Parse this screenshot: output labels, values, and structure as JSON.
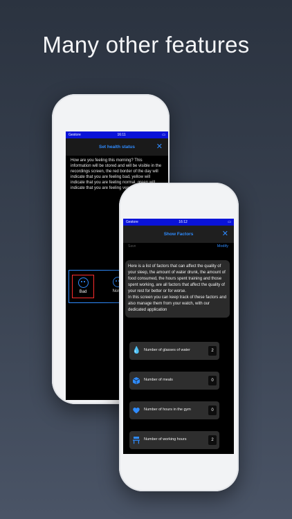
{
  "headline": "Many other features",
  "back_phone": {
    "status": {
      "carrier": "Gestore",
      "time": "16:11"
    },
    "title": "Set health status",
    "description": "How are you feeling this morning? This information will be stored and will be visible in the recordings screen, the red border of the day will indicate that you are feeling bad, yellow will indicate that you are feeling normal, green will indicate that you are feeling very well",
    "moods": [
      {
        "label": "Bad",
        "selected": true
      },
      {
        "label": "Norm",
        "selected": false
      }
    ]
  },
  "front_phone": {
    "status": {
      "carrier": "Gestore",
      "time": "16:12"
    },
    "title": "Show Factors",
    "save_label": "Save",
    "modify_label": "Modify",
    "info_paragraph_1": "Here is a list of factors that can affect the quality of your sleep, the amount of water drunk, the amount of food consumed, the hours spent training and those spent working, are all factors that affect the quality of your rest for better or for worse.",
    "info_paragraph_2": "In this screen you can keep track of these factors and also manage them from your watch, with our dedicated application",
    "factors": [
      {
        "label": "Number of glasses of water",
        "value": "2",
        "icon": "water-drop-icon"
      },
      {
        "label": "Number of meals",
        "value": "0",
        "icon": "food-box-icon"
      },
      {
        "label": "Number of hours in the gym",
        "value": "0",
        "icon": "heart-icon"
      },
      {
        "label": "Number of working hours",
        "value": "2",
        "icon": "desk-icon"
      }
    ]
  },
  "colors": {
    "accent": "#2f8cff",
    "status_bar": "#0a13d8",
    "selected_border": "#ff2d2d"
  }
}
